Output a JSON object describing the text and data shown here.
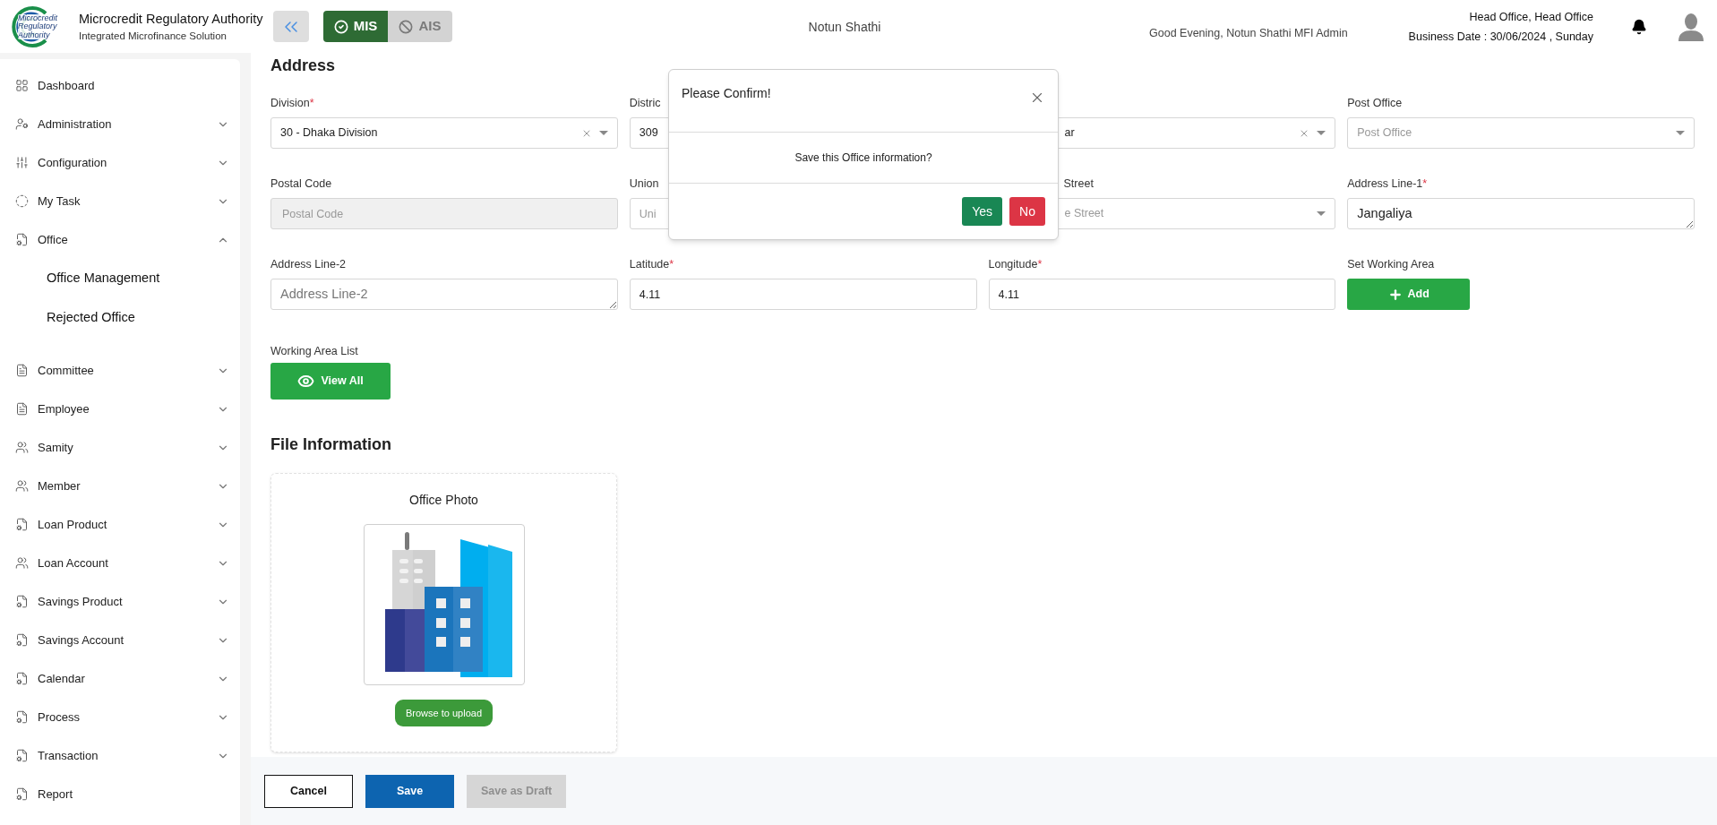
{
  "header": {
    "logo_text": "Microcredit Regulatory Authority",
    "title": "Microcredit Regulatory Authority",
    "subtitle": "Integrated Microfinance Solution",
    "modules": [
      {
        "label": "MIS",
        "selected": true
      },
      {
        "label": "AIS",
        "selected": false
      }
    ],
    "organization": "Notun Shathi",
    "greeting": "Good Evening, Notun Shathi MFI Admin",
    "office": "Head Office, Head Office",
    "business_date": "Business Date : 30/06/2024 , Sunday"
  },
  "sidebar": {
    "items": [
      {
        "label": "Dashboard",
        "kind": "link"
      },
      {
        "label": "Administration",
        "kind": "group",
        "expanded": false
      },
      {
        "label": "Configuration",
        "kind": "group",
        "expanded": false
      },
      {
        "label": "My Task",
        "kind": "group",
        "expanded": false
      },
      {
        "label": "Office",
        "kind": "group",
        "expanded": true,
        "children": [
          {
            "label": "Office Management"
          },
          {
            "label": "Rejected Office"
          }
        ]
      },
      {
        "label": "Committee",
        "kind": "group",
        "expanded": false
      },
      {
        "label": "Employee",
        "kind": "group",
        "expanded": false
      },
      {
        "label": "Samity",
        "kind": "group",
        "expanded": false
      },
      {
        "label": "Member",
        "kind": "group",
        "expanded": false
      },
      {
        "label": "Loan Product",
        "kind": "group",
        "expanded": false
      },
      {
        "label": "Loan Account",
        "kind": "group",
        "expanded": false
      },
      {
        "label": "Savings Product",
        "kind": "group",
        "expanded": false
      },
      {
        "label": "Savings Account",
        "kind": "group",
        "expanded": false
      },
      {
        "label": "Calendar",
        "kind": "group",
        "expanded": false
      },
      {
        "label": "Process",
        "kind": "group",
        "expanded": false
      },
      {
        "label": "Transaction",
        "kind": "group",
        "expanded": false
      },
      {
        "label": "Report",
        "kind": "link"
      }
    ]
  },
  "address": {
    "title": "Address",
    "rows": [
      [
        {
          "kind": "select",
          "label": "Division",
          "required_mark": "*",
          "value": "30 - Dhaka Division",
          "clearable": true
        },
        {
          "kind": "covered_select",
          "label": "Distric",
          "value": "309"
        },
        {
          "kind": "select",
          "value": "ar",
          "clearable": true,
          "partial": true
        },
        {
          "kind": "select",
          "label": "Post Office",
          "placeholder": "Post Office",
          "clearable": false
        }
      ],
      [
        {
          "kind": "input",
          "label": "Postal Code",
          "placeholder": "Postal Code",
          "disabled": true
        },
        {
          "kind": "input",
          "label": "Union",
          "placeholder": "Uni",
          "disabled": false
        },
        {
          "kind": "select",
          "label": "Street",
          "placeholder": "e Street",
          "clearable": false,
          "partial": true
        },
        {
          "kind": "textarea",
          "label": "Address Line-1",
          "required_mark": "*",
          "value": "Jangaliya",
          "disabled": false
        }
      ],
      [
        {
          "kind": "textarea",
          "label": "Address Line-2",
          "placeholder": "Address Line-2",
          "disabled": false
        },
        {
          "kind": "input",
          "label": "Latitude",
          "required_mark": "*",
          "value": "4.11",
          "disabled": false
        },
        {
          "kind": "input",
          "label": "Longitude",
          "required_mark": "*",
          "value": "4.11",
          "disabled": false
        },
        {
          "kind": "button",
          "label": "Set Working Area",
          "button": "Add"
        }
      ]
    ]
  },
  "working_area_list": {
    "label": "Working Area List",
    "button": "View All"
  },
  "file_information": {
    "title": "File Information",
    "photo": {
      "label": "Office Photo",
      "button": "Browse to upload"
    }
  },
  "footer": {
    "buttons": [
      {
        "label": "Cancel",
        "kind": "outline",
        "disabled": false
      },
      {
        "label": "Save",
        "kind": "primary",
        "disabled": false
      },
      {
        "label": "Save as Draft",
        "kind": "primary",
        "disabled": true
      }
    ]
  },
  "dialog": {
    "title": "Please Confirm!",
    "message": "Save this Office information?",
    "buttons": [
      {
        "label": "Yes",
        "kind": "confirm"
      },
      {
        "label": "No",
        "kind": "cancel"
      }
    ]
  }
}
